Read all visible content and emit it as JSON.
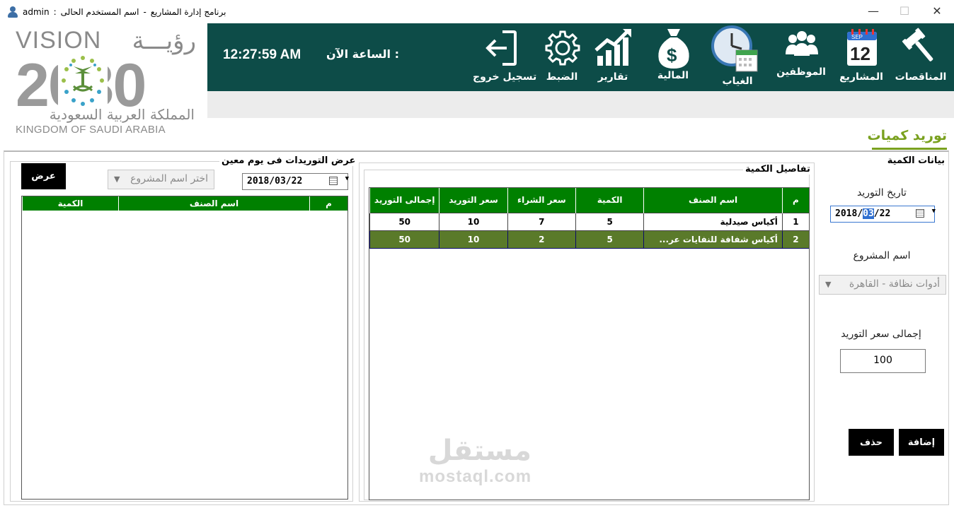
{
  "window": {
    "title": "برنامج إدارة المشاريع",
    "separator": "-",
    "user_label": "اسم المستخدم الحالى",
    "colon": ":",
    "user": "admin",
    "controls": {
      "minimize": "—",
      "maximize": "☐",
      "close": "✕"
    }
  },
  "logo": {
    "vision": "VISION",
    "arabic": "رؤيـــة",
    "year": "2030",
    "kingdom_ar": "المملكة العربية السعودية",
    "kingdom_en": "KINGDOM OF SAUDI ARABIA"
  },
  "header": {
    "time": "12:27:59 AM",
    "time_label": "الساعة الآن :",
    "nav": [
      {
        "label": "المناقصات",
        "icon": "gavel-icon"
      },
      {
        "label": "المشاريع",
        "icon": "calendar-icon",
        "cal_month": "SEP",
        "cal_day": "12"
      },
      {
        "label": "الموظفين",
        "icon": "team-icon"
      },
      {
        "label": "الغياب",
        "icon": "clock-calendar-icon"
      },
      {
        "label": "المالية",
        "icon": "money-bag-icon"
      },
      {
        "label": "تقارير",
        "icon": "bar-chart-icon"
      },
      {
        "label": "الضبط",
        "icon": "gear-icon"
      },
      {
        "label": "تسجيل خروج",
        "icon": "logout-icon"
      }
    ]
  },
  "page": {
    "title": "توريد كميات",
    "accent": "#7aa11f"
  },
  "quantity_panel": {
    "title": "بيانات الكمية",
    "date_label": "تاريخ التوريد",
    "date": {
      "year": "2018",
      "month": "03",
      "day": "22",
      "sep": "/"
    },
    "project_label": "اسم المشروع",
    "project_value": "أدوات نظافة - القاهرة",
    "total_label": "إجمالى سعر التوريد",
    "total_value": "100",
    "add_button": "إضافة",
    "delete_button": "حذف"
  },
  "details_panel": {
    "title": "تفاصيل الكمية",
    "columns": [
      "م",
      "اسم الصنف",
      "الكمية",
      "سعر الشراء",
      "سعر التوريد",
      "إجمالى التوريد"
    ],
    "rows": [
      {
        "no": "1",
        "name": "أكياس صيدلية",
        "qty": "5",
        "buy": "7",
        "supply": "10",
        "total": "50"
      },
      {
        "no": "2",
        "name": "أكياس شفافة للنفايات  عر...",
        "qty": "5",
        "buy": "2",
        "supply": "10",
        "total": "50"
      }
    ]
  },
  "daily_panel": {
    "title": "عرض التوريدات فى يوم معين",
    "date": "2018/03/22",
    "project_placeholder": "اختر اسم المشروع",
    "show_button": "عرض",
    "columns": [
      "م",
      "اسم الصنف",
      "الكمية"
    ]
  },
  "watermark": {
    "arabic": "مستقل",
    "english": "mostaql.com"
  },
  "colors": {
    "header_bg": "#0d4c48",
    "grid_header": "#008000",
    "selected_row": "#5a7a2a"
  }
}
